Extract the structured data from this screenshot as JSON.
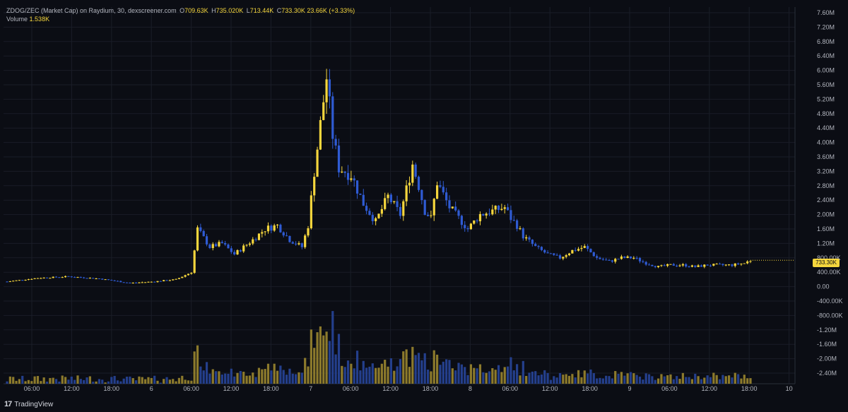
{
  "legend": {
    "symbol": "ZDOG/ZEC (Market Cap) on Raydium, 30, dexscreener.com",
    "open_label": "O",
    "open": "709.63K",
    "high_label": "H",
    "high": "735.020K",
    "low_label": "L",
    "low": "713.44K",
    "close_label": "C",
    "close": "733.30K",
    "change": "23.66K (+3.33%)",
    "volume_label": "Volume",
    "volume": "1.538K"
  },
  "price_badge": "733.30K",
  "brand": {
    "logo": "17",
    "name": "TradingView"
  },
  "colors": {
    "up": "#f5d63d",
    "down": "#2f5bd3",
    "vol_up": "#8c7a2c",
    "vol_down": "#243f8c",
    "grid": "#1a1d27",
    "bg": "#0b0d14"
  },
  "chart_data": {
    "type": "candlestick",
    "y_ticks": [
      "7.60M",
      "7.20M",
      "6.80M",
      "6.40M",
      "6.00M",
      "5.60M",
      "5.20M",
      "4.80M",
      "4.40M",
      "4.00M",
      "3.60M",
      "3.20M",
      "2.80M",
      "2.40M",
      "2.00M",
      "1.60M",
      "1.20M",
      "800.00K",
      "400.00K",
      "0.00",
      "-400.00K",
      "-800.00K",
      "-1.20M",
      "-1.60M",
      "-2.00M",
      "-2.40M"
    ],
    "x_ticks": [
      "06:00",
      "12:00",
      "18:00",
      "6",
      "06:00",
      "12:00",
      "18:00",
      "7",
      "06:00",
      "12:00",
      "18:00",
      "8",
      "06:00",
      "12:00",
      "18:00",
      "9",
      "06:00",
      "12:00",
      "18:00",
      "10"
    ],
    "ylim": [
      -2.4,
      7.6
    ],
    "grid": true,
    "anchors": [
      [
        0,
        0.14
      ],
      [
        10,
        0.24
      ],
      [
        20,
        0.28
      ],
      [
        30,
        0.22
      ],
      [
        40,
        0.1
      ],
      [
        48,
        0.14
      ],
      [
        55,
        0.2
      ],
      [
        60,
        0.4
      ],
      [
        62,
        1.6
      ],
      [
        66,
        1.1
      ],
      [
        70,
        1.2
      ],
      [
        74,
        0.9
      ],
      [
        80,
        1.3
      ],
      [
        84,
        1.6
      ],
      [
        88,
        1.7
      ],
      [
        92,
        1.3
      ],
      [
        96,
        1.1
      ],
      [
        98,
        1.7
      ],
      [
        100,
        3.2
      ],
      [
        104,
        5.8
      ],
      [
        106,
        4.2
      ],
      [
        108,
        3.3
      ],
      [
        112,
        3.1
      ],
      [
        116,
        2.3
      ],
      [
        120,
        1.8
      ],
      [
        124,
        2.5
      ],
      [
        128,
        2.0
      ],
      [
        132,
        3.4
      ],
      [
        134,
        2.8
      ],
      [
        136,
        2.1
      ],
      [
        138,
        1.9
      ],
      [
        140,
        2.9
      ],
      [
        144,
        2.2
      ],
      [
        148,
        1.8
      ],
      [
        150,
        1.6
      ],
      [
        154,
        2.0
      ],
      [
        158,
        2.1
      ],
      [
        162,
        2.2
      ],
      [
        164,
        1.9
      ],
      [
        166,
        1.7
      ],
      [
        168,
        1.4
      ],
      [
        172,
        1.1
      ],
      [
        176,
        0.9
      ],
      [
        180,
        0.8
      ],
      [
        184,
        1.0
      ],
      [
        188,
        1.1
      ],
      [
        192,
        0.8
      ],
      [
        196,
        0.7
      ],
      [
        200,
        0.8
      ],
      [
        204,
        0.8
      ],
      [
        208,
        0.65
      ],
      [
        212,
        0.55
      ],
      [
        216,
        0.6
      ],
      [
        220,
        0.6
      ],
      [
        224,
        0.55
      ],
      [
        228,
        0.6
      ],
      [
        232,
        0.6
      ],
      [
        236,
        0.6
      ],
      [
        240,
        0.65
      ],
      [
        242,
        0.73
      ]
    ]
  }
}
